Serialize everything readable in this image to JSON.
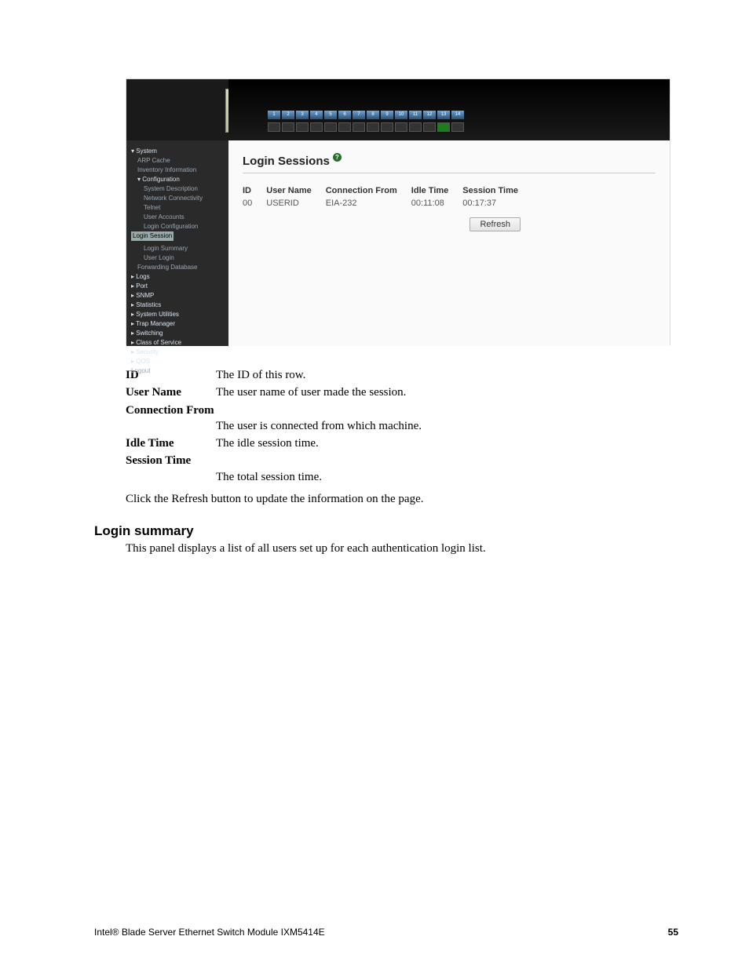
{
  "screenshot": {
    "ports": [
      "1",
      "2",
      "3",
      "4",
      "5",
      "6",
      "7",
      "8",
      "9",
      "10",
      "11",
      "12",
      "13",
      "14"
    ],
    "port_green_index": 12,
    "title": "Login Sessions",
    "table": {
      "headers": [
        "ID",
        "User Name",
        "Connection From",
        "Idle Time",
        "Session Time"
      ],
      "row": [
        "00",
        "USERID",
        "EIA-232",
        "00:11:08",
        "00:17:37"
      ]
    },
    "refresh_label": "Refresh",
    "nav": [
      {
        "t": "System",
        "cls": "item",
        "open": true
      },
      {
        "t": "ARP Cache",
        "cls": "item indent1 gray"
      },
      {
        "t": "Inventory Information",
        "cls": "item indent1 gray"
      },
      {
        "t": "Configuration",
        "cls": "item indent1",
        "open": true
      },
      {
        "t": "System Description",
        "cls": "item indent2 gray"
      },
      {
        "t": "Network Connectivity",
        "cls": "item indent2 gray"
      },
      {
        "t": "Telnet",
        "cls": "item indent2 gray"
      },
      {
        "t": "User Accounts",
        "cls": "item indent2 gray"
      },
      {
        "t": "Login Configuration",
        "cls": "item indent2 gray"
      },
      {
        "t": "Login Session",
        "cls": "item indent2 selected"
      },
      {
        "t": "Login Summary",
        "cls": "item indent2 gray"
      },
      {
        "t": "User Login",
        "cls": "item indent2 gray"
      },
      {
        "t": "Forwarding Database",
        "cls": "item indent1 gray"
      },
      {
        "t": "Logs",
        "cls": "item"
      },
      {
        "t": "Port",
        "cls": "item"
      },
      {
        "t": "SNMP",
        "cls": "item"
      },
      {
        "t": "Statistics",
        "cls": "item"
      },
      {
        "t": "System Utilities",
        "cls": "item"
      },
      {
        "t": "Trap Manager",
        "cls": "item"
      },
      {
        "t": "Switching",
        "cls": "item"
      },
      {
        "t": "Class of Service",
        "cls": "item"
      },
      {
        "t": "Security",
        "cls": "item"
      },
      {
        "t": "QOS",
        "cls": "item"
      },
      {
        "t": "Logout",
        "cls": "item gray"
      }
    ]
  },
  "definitions": [
    {
      "term": "ID",
      "def": "The ID of this row.",
      "wrap": false
    },
    {
      "term": "User Name",
      "def": "The user name of user made the session.",
      "wrap": false
    },
    {
      "term": "Connection From",
      "def": "The user is connected from which machine.",
      "wrap": true
    },
    {
      "term": "Idle Time",
      "def": "The idle session time.",
      "wrap": false
    },
    {
      "term": "Session Time",
      "def": "The total session time.",
      "wrap": true
    }
  ],
  "after_dl": "Click the Refresh button to update the information on the page.",
  "section": {
    "heading": "Login summary",
    "body": "This panel displays a list of all users set up for each authentication login list."
  },
  "footer": {
    "left": "Intel® Blade Server Ethernet Switch Module IXM5414E",
    "right": "55"
  }
}
